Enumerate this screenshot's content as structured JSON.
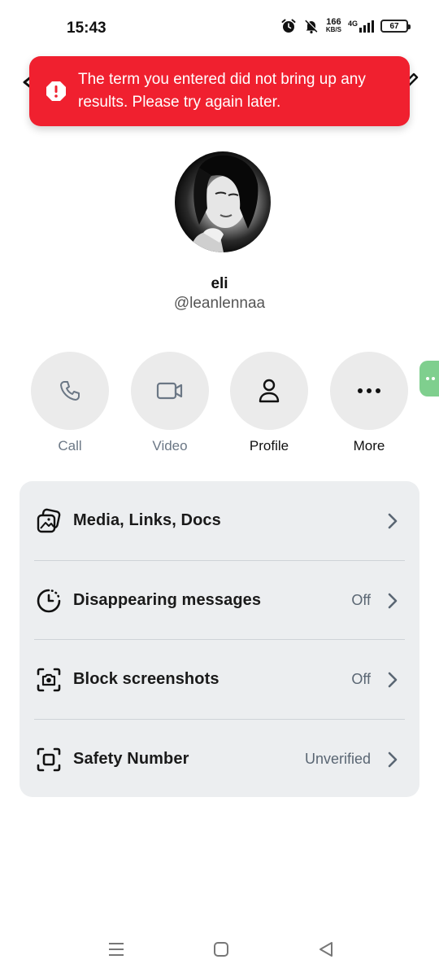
{
  "status_bar": {
    "time": "15:43",
    "net_speed_value": "166",
    "net_speed_unit": "KB/S",
    "network_type": "4G",
    "battery": "67",
    "icons": [
      "alarm-icon",
      "mute-icon",
      "signal-icon",
      "battery-icon"
    ]
  },
  "toast": {
    "message": "The term you entered did not bring up any results. Please try again later.",
    "color": "#f0202f",
    "icon": "alert-icon"
  },
  "contact": {
    "name": "eli",
    "handle": "@leanlennaa"
  },
  "actions": [
    {
      "label": "Call",
      "icon": "phone-icon",
      "state": "disabled"
    },
    {
      "label": "Video",
      "icon": "video-camera-icon",
      "state": "disabled"
    },
    {
      "label": "Profile",
      "icon": "person-icon",
      "state": "enabled"
    },
    {
      "label": "More",
      "icon": "more-dots-icon",
      "state": "enabled"
    }
  ],
  "settings": [
    {
      "label": "Media, Links, Docs",
      "value": "",
      "icon": "media-gallery-icon"
    },
    {
      "label": "Disappearing messages",
      "value": "Off",
      "icon": "timer-icon"
    },
    {
      "label": "Block screenshots",
      "value": "Off",
      "icon": "camera-scan-icon"
    },
    {
      "label": "Safety Number",
      "value": "Unverified",
      "icon": "scan-square-icon"
    }
  ],
  "colors": {
    "accent_green": "#7fcf8e",
    "card_bg": "#eceef0",
    "muted_text": "#5a6673"
  }
}
